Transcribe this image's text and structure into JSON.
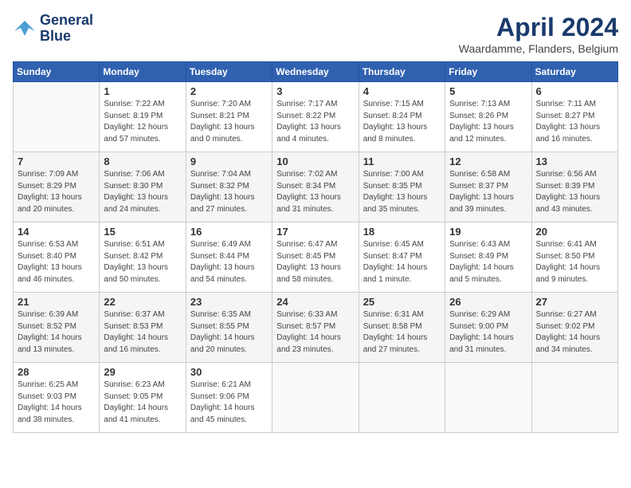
{
  "header": {
    "logo_line1": "General",
    "logo_line2": "Blue",
    "main_title": "April 2024",
    "subtitle": "Waardamme, Flanders, Belgium"
  },
  "columns": [
    "Sunday",
    "Monday",
    "Tuesday",
    "Wednesday",
    "Thursday",
    "Friday",
    "Saturday"
  ],
  "weeks": [
    [
      {
        "day": "",
        "info": ""
      },
      {
        "day": "1",
        "info": "Sunrise: 7:22 AM\nSunset: 8:19 PM\nDaylight: 12 hours\nand 57 minutes."
      },
      {
        "day": "2",
        "info": "Sunrise: 7:20 AM\nSunset: 8:21 PM\nDaylight: 13 hours\nand 0 minutes."
      },
      {
        "day": "3",
        "info": "Sunrise: 7:17 AM\nSunset: 8:22 PM\nDaylight: 13 hours\nand 4 minutes."
      },
      {
        "day": "4",
        "info": "Sunrise: 7:15 AM\nSunset: 8:24 PM\nDaylight: 13 hours\nand 8 minutes."
      },
      {
        "day": "5",
        "info": "Sunrise: 7:13 AM\nSunset: 8:26 PM\nDaylight: 13 hours\nand 12 minutes."
      },
      {
        "day": "6",
        "info": "Sunrise: 7:11 AM\nSunset: 8:27 PM\nDaylight: 13 hours\nand 16 minutes."
      }
    ],
    [
      {
        "day": "7",
        "info": "Sunrise: 7:09 AM\nSunset: 8:29 PM\nDaylight: 13 hours\nand 20 minutes."
      },
      {
        "day": "8",
        "info": "Sunrise: 7:06 AM\nSunset: 8:30 PM\nDaylight: 13 hours\nand 24 minutes."
      },
      {
        "day": "9",
        "info": "Sunrise: 7:04 AM\nSunset: 8:32 PM\nDaylight: 13 hours\nand 27 minutes."
      },
      {
        "day": "10",
        "info": "Sunrise: 7:02 AM\nSunset: 8:34 PM\nDaylight: 13 hours\nand 31 minutes."
      },
      {
        "day": "11",
        "info": "Sunrise: 7:00 AM\nSunset: 8:35 PM\nDaylight: 13 hours\nand 35 minutes."
      },
      {
        "day": "12",
        "info": "Sunrise: 6:58 AM\nSunset: 8:37 PM\nDaylight: 13 hours\nand 39 minutes."
      },
      {
        "day": "13",
        "info": "Sunrise: 6:56 AM\nSunset: 8:39 PM\nDaylight: 13 hours\nand 43 minutes."
      }
    ],
    [
      {
        "day": "14",
        "info": "Sunrise: 6:53 AM\nSunset: 8:40 PM\nDaylight: 13 hours\nand 46 minutes."
      },
      {
        "day": "15",
        "info": "Sunrise: 6:51 AM\nSunset: 8:42 PM\nDaylight: 13 hours\nand 50 minutes."
      },
      {
        "day": "16",
        "info": "Sunrise: 6:49 AM\nSunset: 8:44 PM\nDaylight: 13 hours\nand 54 minutes."
      },
      {
        "day": "17",
        "info": "Sunrise: 6:47 AM\nSunset: 8:45 PM\nDaylight: 13 hours\nand 58 minutes."
      },
      {
        "day": "18",
        "info": "Sunrise: 6:45 AM\nSunset: 8:47 PM\nDaylight: 14 hours\nand 1 minute."
      },
      {
        "day": "19",
        "info": "Sunrise: 6:43 AM\nSunset: 8:49 PM\nDaylight: 14 hours\nand 5 minutes."
      },
      {
        "day": "20",
        "info": "Sunrise: 6:41 AM\nSunset: 8:50 PM\nDaylight: 14 hours\nand 9 minutes."
      }
    ],
    [
      {
        "day": "21",
        "info": "Sunrise: 6:39 AM\nSunset: 8:52 PM\nDaylight: 14 hours\nand 13 minutes."
      },
      {
        "day": "22",
        "info": "Sunrise: 6:37 AM\nSunset: 8:53 PM\nDaylight: 14 hours\nand 16 minutes."
      },
      {
        "day": "23",
        "info": "Sunrise: 6:35 AM\nSunset: 8:55 PM\nDaylight: 14 hours\nand 20 minutes."
      },
      {
        "day": "24",
        "info": "Sunrise: 6:33 AM\nSunset: 8:57 PM\nDaylight: 14 hours\nand 23 minutes."
      },
      {
        "day": "25",
        "info": "Sunrise: 6:31 AM\nSunset: 8:58 PM\nDaylight: 14 hours\nand 27 minutes."
      },
      {
        "day": "26",
        "info": "Sunrise: 6:29 AM\nSunset: 9:00 PM\nDaylight: 14 hours\nand 31 minutes."
      },
      {
        "day": "27",
        "info": "Sunrise: 6:27 AM\nSunset: 9:02 PM\nDaylight: 14 hours\nand 34 minutes."
      }
    ],
    [
      {
        "day": "28",
        "info": "Sunrise: 6:25 AM\nSunset: 9:03 PM\nDaylight: 14 hours\nand 38 minutes."
      },
      {
        "day": "29",
        "info": "Sunrise: 6:23 AM\nSunset: 9:05 PM\nDaylight: 14 hours\nand 41 minutes."
      },
      {
        "day": "30",
        "info": "Sunrise: 6:21 AM\nSunset: 9:06 PM\nDaylight: 14 hours\nand 45 minutes."
      },
      {
        "day": "",
        "info": ""
      },
      {
        "day": "",
        "info": ""
      },
      {
        "day": "",
        "info": ""
      },
      {
        "day": "",
        "info": ""
      }
    ]
  ]
}
